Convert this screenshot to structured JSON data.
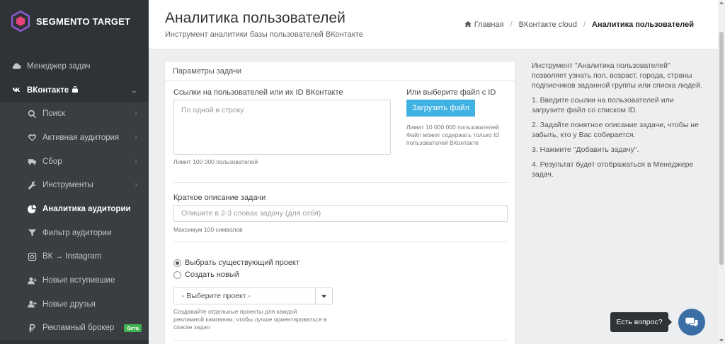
{
  "brand": {
    "name": "SEGMENTO TARGET",
    "colors": {
      "sidebar": "#2f3336",
      "accent": "#3fb1e3",
      "badge": "#3fb34f",
      "chat": "#3a6ea5"
    }
  },
  "sidebar": {
    "items": [
      {
        "label": "Менеджер задач",
        "icon": "cloud-icon"
      },
      {
        "label": "ВКонтакте",
        "icon": "vk-icon"
      },
      {
        "label": "Поиск",
        "icon": "search-icon"
      },
      {
        "label": "Активная аудитория",
        "icon": "heart-icon"
      },
      {
        "label": "Сбор",
        "icon": "truck-icon"
      },
      {
        "label": "Инструменты",
        "icon": "wrench-icon"
      },
      {
        "label": "Аналитика аудитории",
        "icon": "pie-chart-icon"
      },
      {
        "label": "Фильтр аудитории",
        "icon": "filter-icon"
      },
      {
        "label": "ВК → Instagram",
        "icon": "instagram-icon"
      },
      {
        "label": "Новые вступившие",
        "icon": "user-plus-icon"
      },
      {
        "label": "Новые друзья",
        "icon": "user-plus-icon"
      },
      {
        "label": "Рекламный брокер",
        "icon": "ruble-icon",
        "badge": "бета"
      }
    ]
  },
  "header": {
    "title": "Аналитика пользователей",
    "subtitle": "Инструмент аналитики базы пользователей ВКонтакте",
    "breadcrumb": [
      "Главная",
      "ВКонтакте cloud",
      "Аналитика пользователей"
    ]
  },
  "panel": {
    "heading": "Параметры задачи",
    "links_label": "Ссылки на пользователей или их ID ВКонтакте",
    "links_placeholder": "По одной в строку",
    "links_limit": "Лимит 100 000 пользователей",
    "file_label": "Или выберите файл с ID",
    "upload_button": "Загрузить файл",
    "file_hint_1": "Лимит 10 000 000 пользователей",
    "file_hint_2": "Файл может содержать только ID",
    "file_hint_3": "пользователей ВКонтакте",
    "desc_label": "Краткое описание задачи",
    "desc_placeholder": "Опишите в 2-3 словах задачу (для себя)",
    "desc_limit": "Максимум 100 символов",
    "radio_existing": "Выбрать существующий проект",
    "radio_new": "Создать новый",
    "select_value": "- Выберите проект -",
    "project_hint_1": "Создавайте отдельные проекты для каждой",
    "project_hint_2": "рекламной кампании, чтобы лучше ориентироваться в",
    "project_hint_3": "списке задач"
  },
  "info": {
    "intro": "Инструмент \"Аналитика пользователей\" позволяет узнать пол, возраст, города, страны подписчиков заданной группы или списка людей.",
    "step1": "1. Введите ссылки на пользователей или загрузите файл со списком ID.",
    "step2": "2. Задайте понятное описание задачи, чтобы не забыть, кто у Вас собирается.",
    "step3": "3. Нажмите \"Добавить задачу\".",
    "step4": "4. Результат будет отображаться в Менеджере задач."
  },
  "chat": {
    "tooltip": "Есть вопрос?"
  }
}
